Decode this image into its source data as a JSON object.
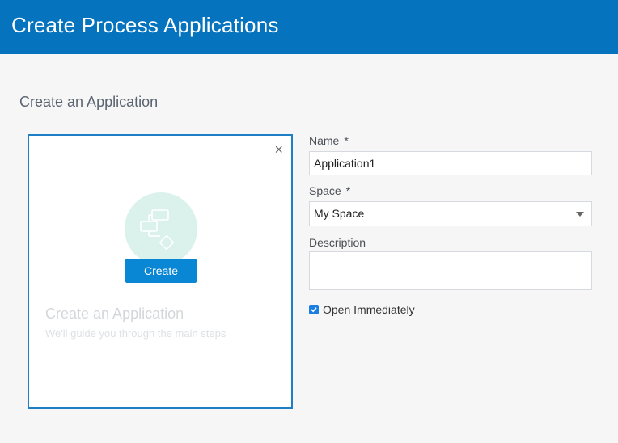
{
  "header": {
    "title": "Create Process Applications"
  },
  "section": {
    "title": "Create an Application"
  },
  "card": {
    "close_symbol": "×",
    "illustration_icon": "process-flow-icon",
    "create_label": "Create",
    "title": "Create an Application",
    "subtitle": "We'll guide you through the main steps"
  },
  "form": {
    "name": {
      "label": "Name",
      "required_mark": "*",
      "value": "Application1"
    },
    "space": {
      "label": "Space",
      "required_mark": "*",
      "selected": "My Space"
    },
    "description": {
      "label": "Description",
      "value": ""
    },
    "open_immediately": {
      "label": "Open Immediately",
      "checked": true
    }
  },
  "colors": {
    "header_bg": "#0573be",
    "accent": "#0a87d4",
    "card_border": "#1f7fc6",
    "illustration_bg": "#daf1ec",
    "checkbox": "#1a7fe0"
  }
}
